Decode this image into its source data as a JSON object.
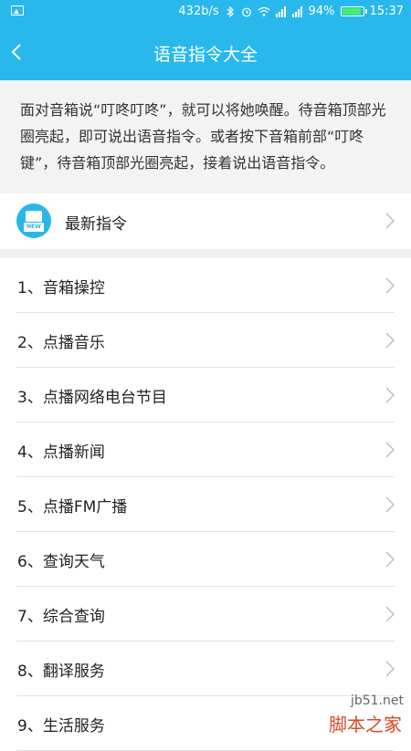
{
  "status_bar": {
    "network_speed": "432b/s",
    "battery_percent": "94%",
    "battery_level": 0.94,
    "time": "15:37",
    "icons": [
      "image-icon",
      "bluetooth-icon",
      "alarm-icon",
      "wifi-icon",
      "signal-icon",
      "signal-icon",
      "battery-icon"
    ]
  },
  "header": {
    "title": "语音指令大全",
    "back_icon": "chevron-left-icon"
  },
  "intro": {
    "text": "面对音箱说“叮咚叮咚”，就可以将她唤醒。待音箱顶部光圈亮起，即可说出语音指令。或者按下音箱前部“叮咚键”，待音箱顶部光圈亮起，接着说出语音指令。"
  },
  "latest": {
    "label": "最新指令",
    "icon": "new-badge-icon",
    "icon_text": "NEW"
  },
  "commands": [
    {
      "label": "1、音箱操控"
    },
    {
      "label": "2、点播音乐"
    },
    {
      "label": "3、点播网络电台节目"
    },
    {
      "label": "4、点播新闻"
    },
    {
      "label": "5、点播FM广播"
    },
    {
      "label": "6、查询天气"
    },
    {
      "label": "7、综合查询"
    },
    {
      "label": "8、翻译服务"
    },
    {
      "label": "9、生活服务"
    }
  ],
  "watermark": {
    "url": "jb51.net",
    "name": "脚本之家"
  },
  "colors": {
    "accent": "#29b8ec",
    "background": "#f3f3f3",
    "divider": "#e1e1e1",
    "chevron": "#bdbdbd"
  }
}
